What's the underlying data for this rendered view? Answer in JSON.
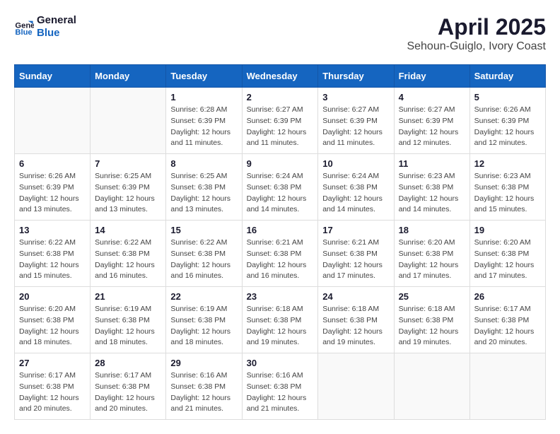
{
  "header": {
    "logo_line1": "General",
    "logo_line2": "Blue",
    "title": "April 2025",
    "subtitle": "Sehoun-Guiglo, Ivory Coast"
  },
  "weekdays": [
    "Sunday",
    "Monday",
    "Tuesday",
    "Wednesday",
    "Thursday",
    "Friday",
    "Saturday"
  ],
  "weeks": [
    [
      {
        "day": "",
        "info": ""
      },
      {
        "day": "",
        "info": ""
      },
      {
        "day": "1",
        "info": "Sunrise: 6:28 AM\nSunset: 6:39 PM\nDaylight: 12 hours and 11 minutes."
      },
      {
        "day": "2",
        "info": "Sunrise: 6:27 AM\nSunset: 6:39 PM\nDaylight: 12 hours and 11 minutes."
      },
      {
        "day": "3",
        "info": "Sunrise: 6:27 AM\nSunset: 6:39 PM\nDaylight: 12 hours and 11 minutes."
      },
      {
        "day": "4",
        "info": "Sunrise: 6:27 AM\nSunset: 6:39 PM\nDaylight: 12 hours and 12 minutes."
      },
      {
        "day": "5",
        "info": "Sunrise: 6:26 AM\nSunset: 6:39 PM\nDaylight: 12 hours and 12 minutes."
      }
    ],
    [
      {
        "day": "6",
        "info": "Sunrise: 6:26 AM\nSunset: 6:39 PM\nDaylight: 12 hours and 13 minutes."
      },
      {
        "day": "7",
        "info": "Sunrise: 6:25 AM\nSunset: 6:39 PM\nDaylight: 12 hours and 13 minutes."
      },
      {
        "day": "8",
        "info": "Sunrise: 6:25 AM\nSunset: 6:38 PM\nDaylight: 12 hours and 13 minutes."
      },
      {
        "day": "9",
        "info": "Sunrise: 6:24 AM\nSunset: 6:38 PM\nDaylight: 12 hours and 14 minutes."
      },
      {
        "day": "10",
        "info": "Sunrise: 6:24 AM\nSunset: 6:38 PM\nDaylight: 12 hours and 14 minutes."
      },
      {
        "day": "11",
        "info": "Sunrise: 6:23 AM\nSunset: 6:38 PM\nDaylight: 12 hours and 14 minutes."
      },
      {
        "day": "12",
        "info": "Sunrise: 6:23 AM\nSunset: 6:38 PM\nDaylight: 12 hours and 15 minutes."
      }
    ],
    [
      {
        "day": "13",
        "info": "Sunrise: 6:22 AM\nSunset: 6:38 PM\nDaylight: 12 hours and 15 minutes."
      },
      {
        "day": "14",
        "info": "Sunrise: 6:22 AM\nSunset: 6:38 PM\nDaylight: 12 hours and 16 minutes."
      },
      {
        "day": "15",
        "info": "Sunrise: 6:22 AM\nSunset: 6:38 PM\nDaylight: 12 hours and 16 minutes."
      },
      {
        "day": "16",
        "info": "Sunrise: 6:21 AM\nSunset: 6:38 PM\nDaylight: 12 hours and 16 minutes."
      },
      {
        "day": "17",
        "info": "Sunrise: 6:21 AM\nSunset: 6:38 PM\nDaylight: 12 hours and 17 minutes."
      },
      {
        "day": "18",
        "info": "Sunrise: 6:20 AM\nSunset: 6:38 PM\nDaylight: 12 hours and 17 minutes."
      },
      {
        "day": "19",
        "info": "Sunrise: 6:20 AM\nSunset: 6:38 PM\nDaylight: 12 hours and 17 minutes."
      }
    ],
    [
      {
        "day": "20",
        "info": "Sunrise: 6:20 AM\nSunset: 6:38 PM\nDaylight: 12 hours and 18 minutes."
      },
      {
        "day": "21",
        "info": "Sunrise: 6:19 AM\nSunset: 6:38 PM\nDaylight: 12 hours and 18 minutes."
      },
      {
        "day": "22",
        "info": "Sunrise: 6:19 AM\nSunset: 6:38 PM\nDaylight: 12 hours and 18 minutes."
      },
      {
        "day": "23",
        "info": "Sunrise: 6:18 AM\nSunset: 6:38 PM\nDaylight: 12 hours and 19 minutes."
      },
      {
        "day": "24",
        "info": "Sunrise: 6:18 AM\nSunset: 6:38 PM\nDaylight: 12 hours and 19 minutes."
      },
      {
        "day": "25",
        "info": "Sunrise: 6:18 AM\nSunset: 6:38 PM\nDaylight: 12 hours and 19 minutes."
      },
      {
        "day": "26",
        "info": "Sunrise: 6:17 AM\nSunset: 6:38 PM\nDaylight: 12 hours and 20 minutes."
      }
    ],
    [
      {
        "day": "27",
        "info": "Sunrise: 6:17 AM\nSunset: 6:38 PM\nDaylight: 12 hours and 20 minutes."
      },
      {
        "day": "28",
        "info": "Sunrise: 6:17 AM\nSunset: 6:38 PM\nDaylight: 12 hours and 20 minutes."
      },
      {
        "day": "29",
        "info": "Sunrise: 6:16 AM\nSunset: 6:38 PM\nDaylight: 12 hours and 21 minutes."
      },
      {
        "day": "30",
        "info": "Sunrise: 6:16 AM\nSunset: 6:38 PM\nDaylight: 12 hours and 21 minutes."
      },
      {
        "day": "",
        "info": ""
      },
      {
        "day": "",
        "info": ""
      },
      {
        "day": "",
        "info": ""
      }
    ]
  ]
}
